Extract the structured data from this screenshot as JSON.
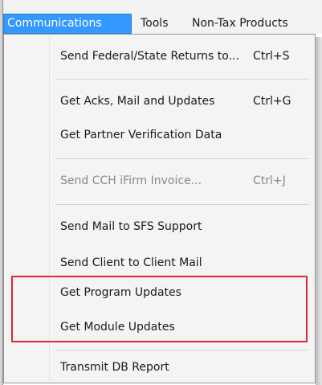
{
  "menubar": {
    "items": [
      {
        "label": "Communications",
        "active": true
      },
      {
        "label": "Tools",
        "active": false
      },
      {
        "label": "Non-Tax Products",
        "active": false
      }
    ]
  },
  "menu": {
    "items": [
      {
        "label": "Send Federal/State Returns to...",
        "shortcut": "Ctrl+S",
        "enabled": true
      },
      {
        "label": "Get Acks, Mail and Updates",
        "shortcut": "Ctrl+G",
        "enabled": true
      },
      {
        "label": "Get Partner Verification Data",
        "shortcut": "",
        "enabled": true
      },
      {
        "label": "Send CCH iFirm Invoice...",
        "shortcut": "Ctrl+J",
        "enabled": false
      },
      {
        "label": "Send Mail to SFS Support",
        "shortcut": "",
        "enabled": true
      },
      {
        "label": "Send Client to Client Mail",
        "shortcut": "",
        "enabled": true
      },
      {
        "label": "Get Program Updates",
        "shortcut": "",
        "enabled": true
      },
      {
        "label": "Get Module Updates",
        "shortcut": "",
        "enabled": true
      },
      {
        "label": "Transmit DB Report",
        "shortcut": "",
        "enabled": true
      }
    ]
  },
  "colors": {
    "menubar_active_bg": "#3399ff",
    "highlight_border": "#d92b3a",
    "disabled_text": "#8a8a8a"
  }
}
